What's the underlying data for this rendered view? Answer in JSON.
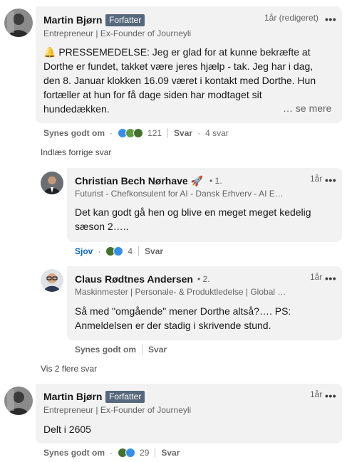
{
  "comments": [
    {
      "author": "Martin Bjørn",
      "badge": "Forfatter",
      "headline": "Entrepreneur | Ex-Founder of Journeyli",
      "time": "1år (redigeret)",
      "text_lines": [
        "🔔 PRESSEMEDELSE: Jeg er glad for at kunne bekræfte at",
        "Dorthe er fundet, takket være jeres hjælp - tak. Jeg har i dag,",
        "den 8. Januar klokken 16.09 været i kontakt med Dorthe. Hun",
        "fortæller at hun for få dage siden har modtaget sit",
        "hundedækken."
      ],
      "see_more": "… se mere",
      "like_label": "Synes godt om",
      "reaction_count": "121",
      "reply_label": "Svar",
      "reply_count": "4 svar"
    },
    {
      "author": "Christian Bech Nørhave 🚀",
      "degree": "• 1.",
      "headline": "Futurist - Chefkonsulent for AI - Dansk Erhverv - AI E…",
      "time": "1år",
      "text_lines": [
        "Det kan godt gå hen og blive en meget meget kedelig",
        "sæson 2….."
      ],
      "like_label": "Sjov",
      "reaction_count": "4",
      "reply_label": "Svar"
    },
    {
      "author": "Claus Rødtnes Andersen",
      "degree": "• 2.",
      "headline": "Maskinmester | Personale- & Produktledelse | Global …",
      "time": "1år",
      "text_lines": [
        "Så med \"omgående\" mener Dorthe altså?…. PS:",
        "Anmeldelsen er der stadig i skrivende stund."
      ],
      "like_label": "Synes godt om",
      "reply_label": "Svar"
    },
    {
      "author": "Martin Bjørn",
      "badge": "Forfatter",
      "headline": "Entrepreneur | Ex-Founder of Journeyli",
      "time": "1år",
      "text_lines": [
        "Delt i 2605"
      ],
      "like_label": "Synes godt om",
      "reaction_count": "29",
      "reply_label": "Svar"
    }
  ],
  "load_previous": "Indlæs forrige svar",
  "show_more": "Vis 2 flere svar",
  "colors": {
    "bubble": "#f2f2f2",
    "badge": "#56687a",
    "accent": "#0a66c2",
    "like_icon": "#378fe9",
    "celebrate_icon": "#44712e",
    "insight_icon": "#e7a33e"
  },
  "icons": [
    "more-icon",
    "like-reaction-icon",
    "celebrate-reaction-icon",
    "funny-reaction-icon"
  ]
}
